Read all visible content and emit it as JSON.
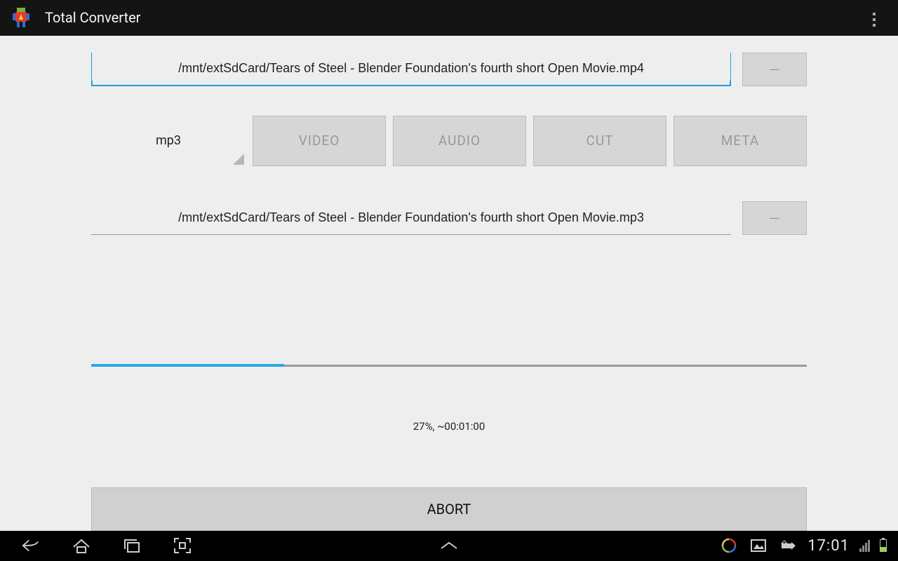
{
  "actionbar": {
    "title": "Total Converter"
  },
  "source": {
    "path": "/mnt/extSdCard/Tears of Steel - Blender Foundation's fourth short Open Movie.mp4",
    "browse_label": "---"
  },
  "format": {
    "selected": "mp3"
  },
  "tabs": {
    "video": "VIDEO",
    "audio": "AUDIO",
    "cut": "CUT",
    "meta": "META"
  },
  "destination": {
    "path": "/mnt/extSdCard/Tears of Steel - Blender Foundation's fourth short Open Movie.mp3",
    "browse_label": "---"
  },
  "progress": {
    "percent": 27,
    "text": "27%, ~00:01:00"
  },
  "action": {
    "abort_label": "ABORT"
  },
  "statusbar": {
    "time": "17:01"
  },
  "colors": {
    "accent": "#29a9e8",
    "button": "#d6d6d6",
    "bg": "#eeeeee"
  }
}
